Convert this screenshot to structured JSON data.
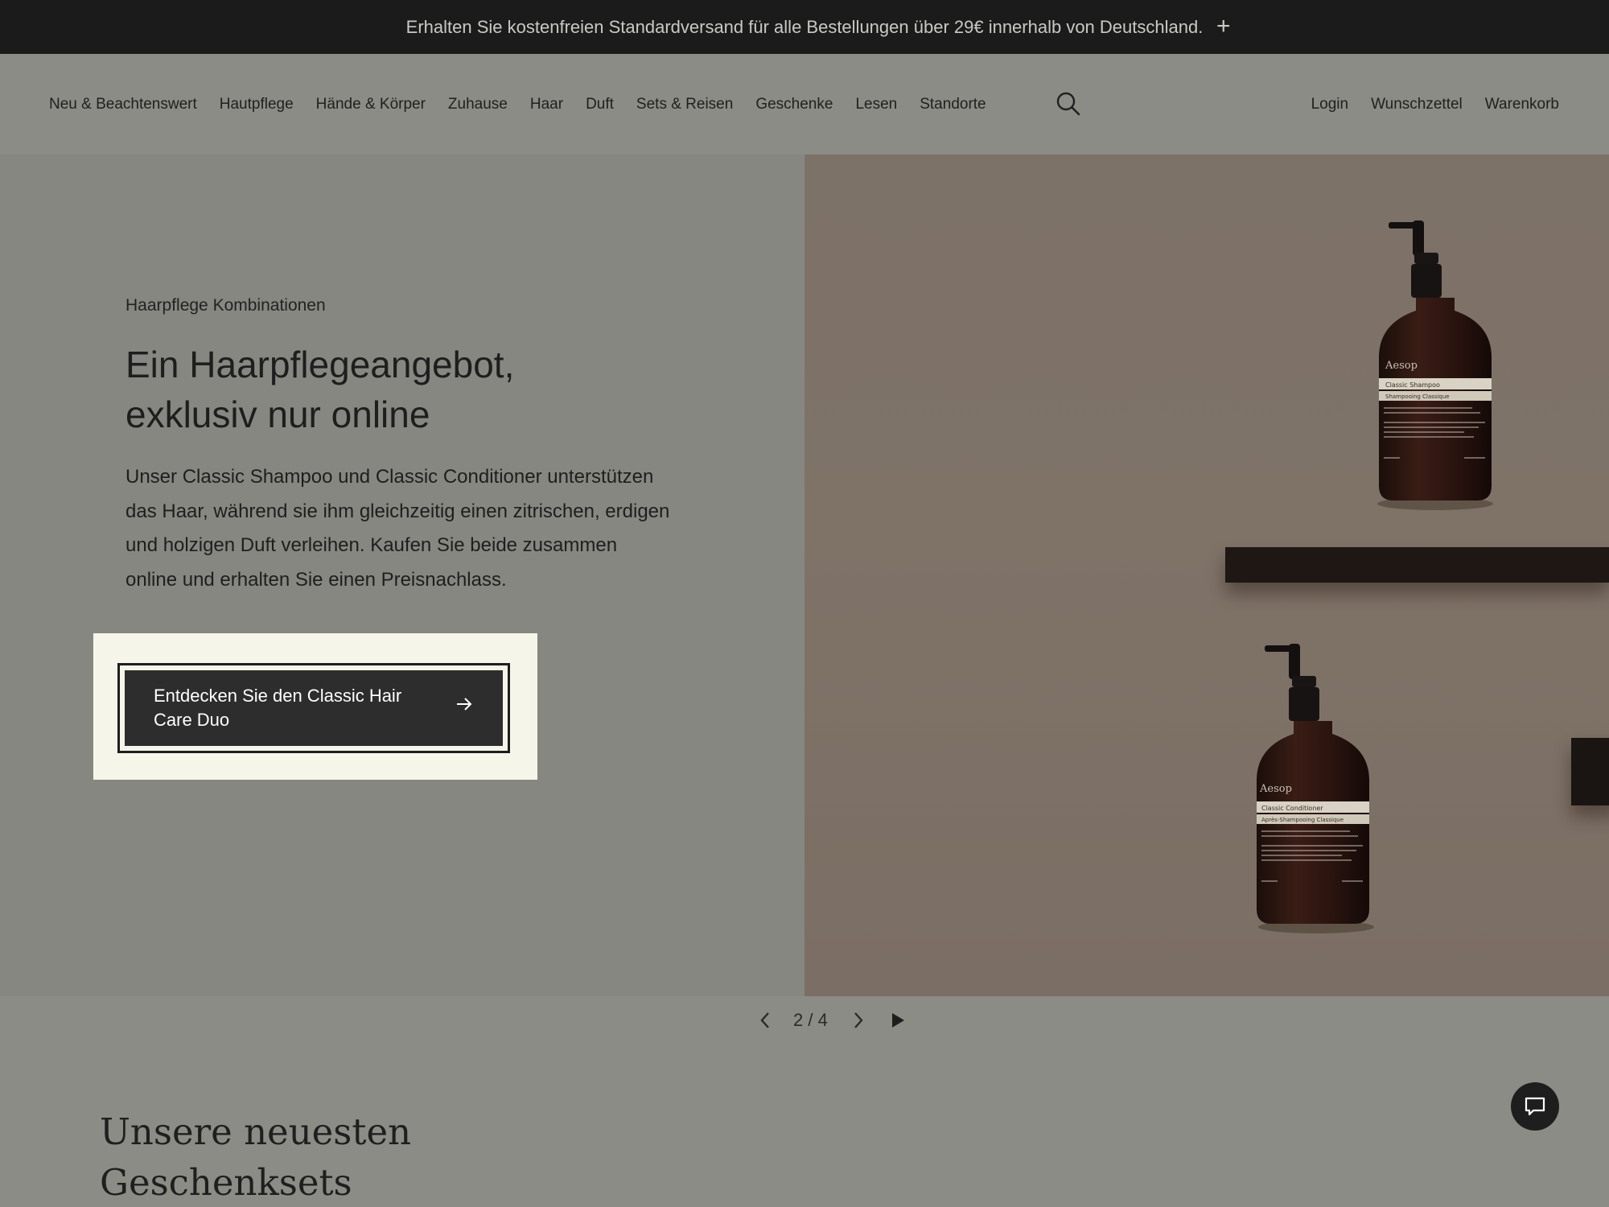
{
  "announcement": {
    "text": "Erhalten Sie kostenfreien Standardversand für alle Bestellungen über 29€ innerhalb von Deutschland.",
    "expand_icon": "plus-icon"
  },
  "nav": {
    "items": [
      {
        "label": "Neu & Beachtenswert"
      },
      {
        "label": "Hautpflege"
      },
      {
        "label": "Hände & Körper"
      },
      {
        "label": "Zuhause"
      },
      {
        "label": "Haar"
      },
      {
        "label": "Duft"
      },
      {
        "label": "Sets & Reisen"
      },
      {
        "label": "Geschenke"
      },
      {
        "label": "Lesen"
      },
      {
        "label": "Standorte"
      }
    ],
    "search_icon": "search-icon",
    "right": {
      "login": "Login",
      "wishlist": "Wunschzettel",
      "cart": "Warenkorb"
    }
  },
  "hero": {
    "eyebrow": "Haarpflege Kombinationen",
    "headline_line1": "Ein Haarpflegeangebot,",
    "headline_line2": "exklusiv nur online",
    "body": "Unser Classic Shampoo und Classic Conditioner unterstützen das Haar, während sie ihm gleichzeitig einen zitrischen, erdigen und holzigen Duft verleihen. Kaufen Sie beide zusammen online und erhalten Sie einen Preisnachlass.",
    "cta_label": "Entdecken Sie den Classic Hair Care Duo",
    "cta_icon": "arrow-right-icon",
    "bottle1": {
      "brand": "Aesop",
      "name": "Classic Shampoo",
      "subname": "Shampooing Classique"
    },
    "bottle2": {
      "brand": "Aesop",
      "name": "Classic Conditioner",
      "subname": "Après-Shampooing Classique"
    }
  },
  "carousel": {
    "counter": "2 / 4",
    "prev_icon": "chevron-left-icon",
    "next_icon": "chevron-right-icon",
    "play_icon": "play-icon"
  },
  "section": {
    "title_line1": "Unsere neuesten",
    "title_line2": "Geschenksets"
  },
  "chat": {
    "icon": "chat-icon"
  },
  "colors": {
    "announcement_bg": "#1b1b1b",
    "page_bg": "#8c8c86",
    "cta_bg": "#2d2d2d",
    "cta_highlight": "#f5f5ea",
    "photo_bg": "#7d7268"
  }
}
